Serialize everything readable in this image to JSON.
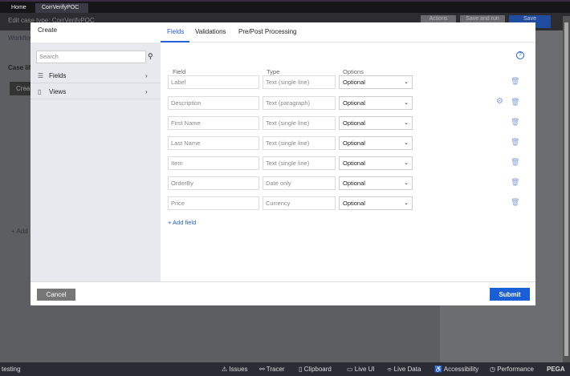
{
  "topbar": {
    "tabs": [
      "Home",
      "CorrVerifyPOC"
    ]
  },
  "header": {
    "title": "Edit case type: CorrVerifyPOC",
    "buttons": [
      "Actions",
      "Save and run",
      "Save"
    ]
  },
  "background": {
    "tab": "Workflow",
    "section": "Case life cycle",
    "stage": "Create",
    "add": "+ Add"
  },
  "modal": {
    "title": "Create",
    "tabs": [
      "Fields",
      "Validations",
      "Pre/Post Processing"
    ],
    "search_placeholder": "Search",
    "nav": [
      {
        "label": "Fields",
        "icon": "list-icon"
      },
      {
        "label": "Views",
        "icon": "clipboard-icon"
      }
    ],
    "columns": [
      "Field",
      "Type",
      "Options"
    ],
    "rows": [
      {
        "field": "Label",
        "type": "Text (single line)",
        "option": "Optional",
        "gear": false
      },
      {
        "field": "Description",
        "type": "Text (paragraph)",
        "option": "Optional",
        "gear": true
      },
      {
        "field": "First Name",
        "type": "Text (single line)",
        "option": "Optional",
        "gear": false
      },
      {
        "field": "Last Name",
        "type": "Text (single line)",
        "option": "Optional",
        "gear": false
      },
      {
        "field": "Item",
        "type": "Text (single line)",
        "option": "Optional",
        "gear": false
      },
      {
        "field": "OrderBy",
        "type": "Date only",
        "option": "Optional",
        "gear": false
      },
      {
        "field": "Price",
        "type": "Currency",
        "option": "Optional",
        "gear": false
      }
    ],
    "add_field": "+ Add field",
    "cancel": "Cancel",
    "submit": "Submit"
  },
  "statusbar": {
    "left": "testing",
    "items": [
      "⚠ Issues",
      "⚯ Tracer",
      "▯ Clipboard",
      "▭ Live UI",
      "⌯ Live Data",
      "♿ Accessibility",
      "◷ Performance"
    ],
    "brand": "PEGA"
  }
}
